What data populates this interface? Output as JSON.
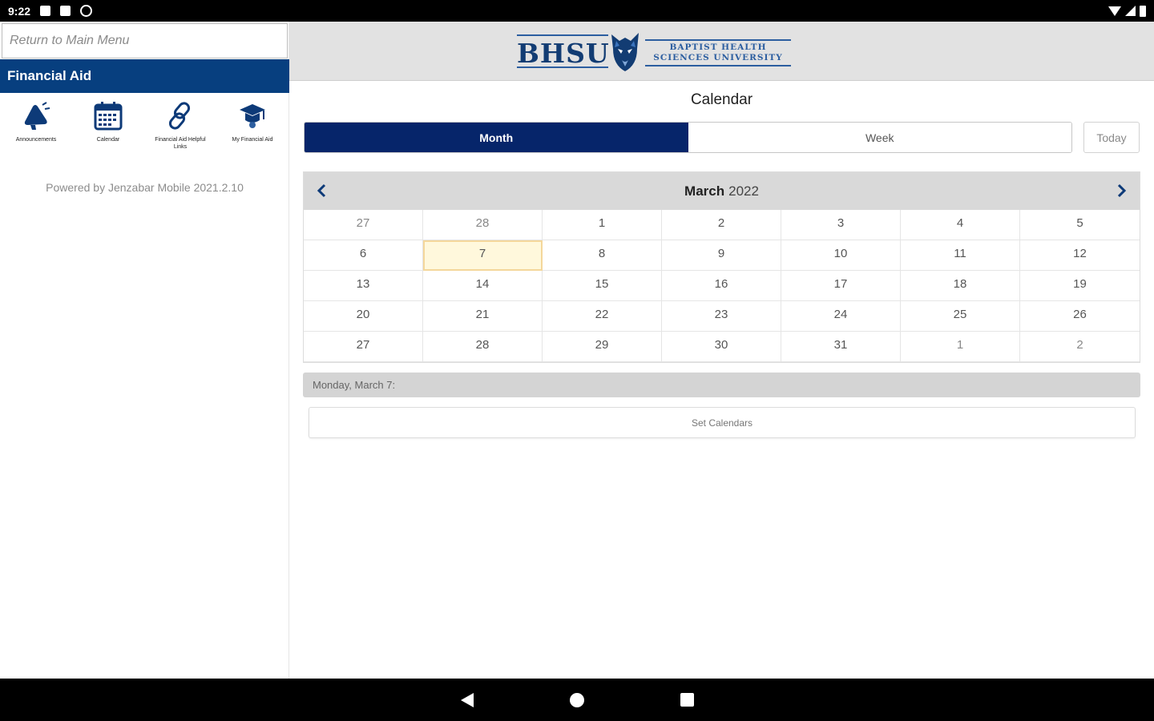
{
  "status_bar": {
    "time": "9:22"
  },
  "sidebar": {
    "return_label": "Return to Main Menu",
    "section_title": "Financial Aid",
    "items": [
      {
        "label": "Announcements"
      },
      {
        "label": "Calendar"
      },
      {
        "label": "Financial Aid Helpful Links"
      },
      {
        "label": "My Financial Aid"
      }
    ],
    "powered_by": "Powered by Jenzabar Mobile 2021.2.10"
  },
  "header": {
    "logo_text": "BHSU",
    "logo_line1": "BAPTIST HEALTH",
    "logo_line2": "SCIENCES UNIVERSITY"
  },
  "main": {
    "title": "Calendar",
    "view_tabs": [
      {
        "label": "Month"
      },
      {
        "label": "Week"
      }
    ],
    "today_label": "Today",
    "month_name": "March",
    "year": "2022",
    "days": [
      [
        "27",
        "28",
        "1",
        "2",
        "3",
        "4",
        "5"
      ],
      [
        "6",
        "7",
        "8",
        "9",
        "10",
        "11",
        "12"
      ],
      [
        "13",
        "14",
        "15",
        "16",
        "17",
        "18",
        "19"
      ],
      [
        "20",
        "21",
        "22",
        "23",
        "24",
        "25",
        "26"
      ],
      [
        "27",
        "28",
        "29",
        "30",
        "31",
        "1",
        "2"
      ]
    ],
    "selected_date_text": "Monday, March 7:",
    "set_calendars_label": "Set Calendars"
  },
  "colors": {
    "brand_navy": "#073f7f",
    "active_tab": "#06256a",
    "selected_cell_bg": "#fff8dc"
  }
}
